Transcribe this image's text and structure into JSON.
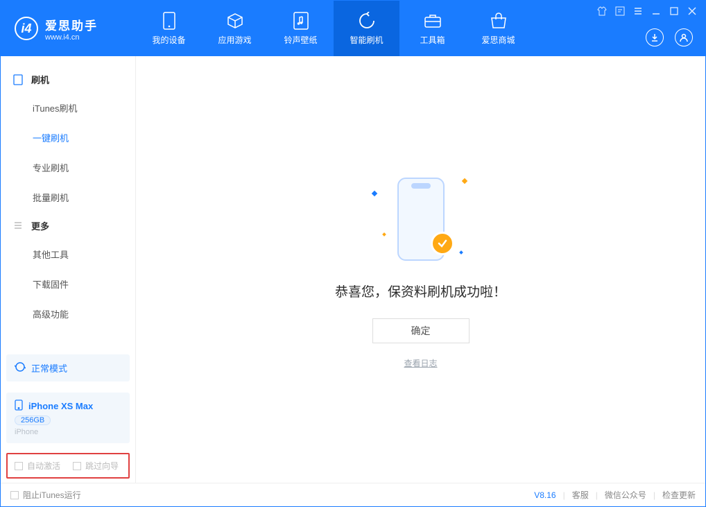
{
  "app": {
    "title": "爱思助手",
    "subtitle": "www.i4.cn"
  },
  "nav": {
    "tabs": [
      {
        "label": "我的设备",
        "icon": "phone-icon"
      },
      {
        "label": "应用游戏",
        "icon": "cube-icon"
      },
      {
        "label": "铃声壁纸",
        "icon": "music-icon"
      },
      {
        "label": "智能刷机",
        "icon": "refresh-icon"
      },
      {
        "label": "工具箱",
        "icon": "toolbox-icon"
      },
      {
        "label": "爱思商城",
        "icon": "store-icon"
      }
    ],
    "selected_index": 3
  },
  "sidebar": {
    "groups": [
      {
        "label": "刷机",
        "items": [
          "iTunes刷机",
          "一键刷机",
          "专业刷机",
          "批量刷机"
        ],
        "sel_index": 1
      },
      {
        "label": "更多",
        "items": [
          "其他工具",
          "下载固件",
          "高级功能"
        ],
        "sel_index": -1
      }
    ]
  },
  "device": {
    "mode": "正常模式",
    "name": "iPhone XS Max",
    "capacity": "256GB",
    "type": "iPhone"
  },
  "options": {
    "auto_activate": "自动激活",
    "skip_guide": "跳过向导"
  },
  "main": {
    "message": "恭喜您，保资料刷机成功啦！",
    "ok": "确定",
    "view_log": "查看日志"
  },
  "footer": {
    "block_itunes": "阻止iTunes运行",
    "version": "V8.16",
    "links": [
      "客服",
      "微信公众号",
      "检查更新"
    ]
  }
}
